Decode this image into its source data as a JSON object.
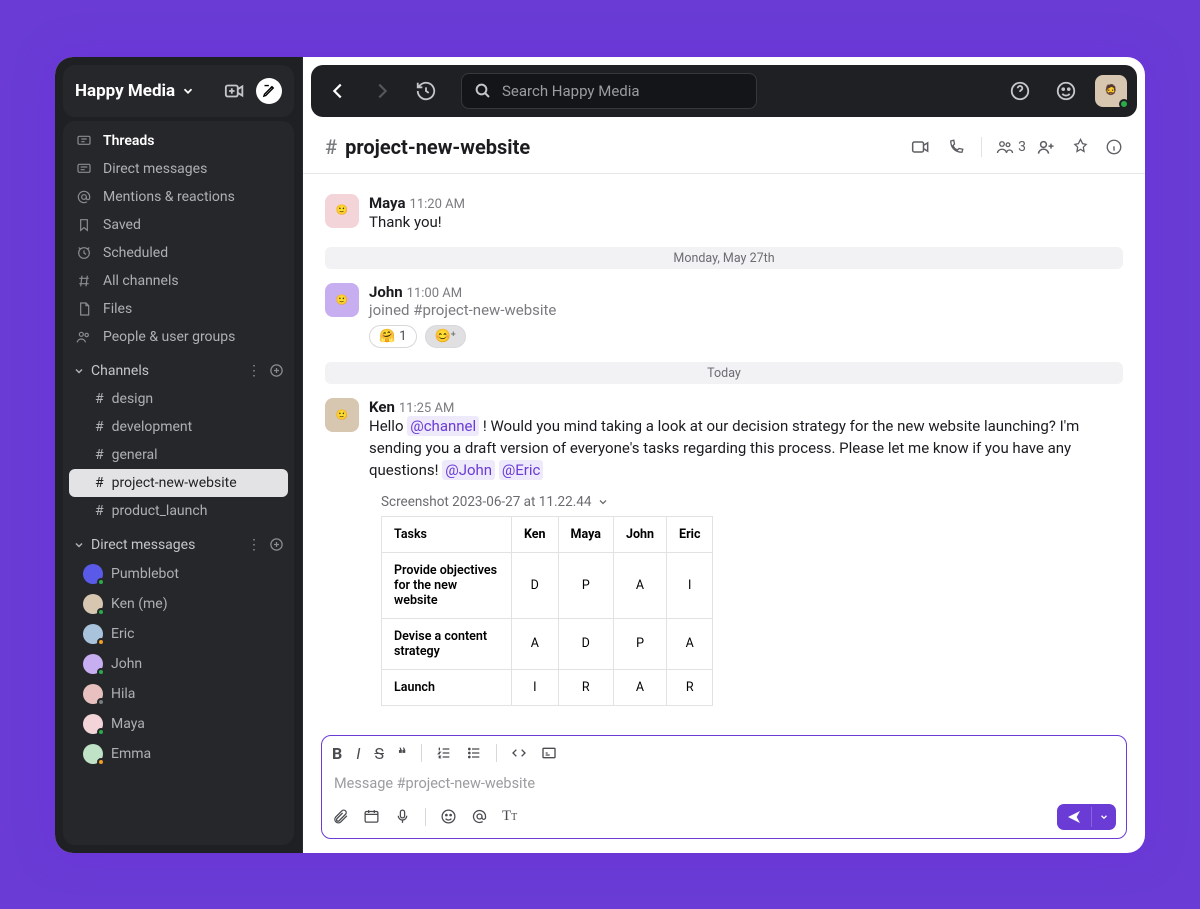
{
  "workspace": {
    "name": "Happy Media"
  },
  "search": {
    "placeholder": "Search Happy Media"
  },
  "nav": [
    {
      "icon": "threads",
      "label": "Threads",
      "active": true
    },
    {
      "icon": "dm",
      "label": "Direct messages"
    },
    {
      "icon": "at",
      "label": "Mentions & reactions"
    },
    {
      "icon": "bookmark",
      "label": "Saved"
    },
    {
      "icon": "clock",
      "label": "Scheduled"
    },
    {
      "icon": "hashes",
      "label": "All channels"
    },
    {
      "icon": "file",
      "label": "Files"
    },
    {
      "icon": "people",
      "label": "People & user groups"
    }
  ],
  "sections": {
    "channels": {
      "title": "Channels",
      "items": [
        {
          "name": "design"
        },
        {
          "name": "development"
        },
        {
          "name": "general"
        },
        {
          "name": "project-new-website",
          "selected": true
        },
        {
          "name": "product_launch"
        }
      ]
    },
    "dms": {
      "title": "Direct messages",
      "items": [
        {
          "name": "Pumblebot",
          "status": "online",
          "color": "#5a5ae8"
        },
        {
          "name": "Ken (me)",
          "status": "online",
          "color": "#d7c6b0"
        },
        {
          "name": "Eric",
          "status": "away",
          "color": "#aac3dd"
        },
        {
          "name": "John",
          "status": "online",
          "color": "#c7aef0"
        },
        {
          "name": "Hila",
          "status": "offline",
          "color": "#e8c0c0"
        },
        {
          "name": "Maya",
          "status": "online",
          "color": "#f3d4d9"
        },
        {
          "name": "Emma",
          "status": "away",
          "color": "#c0e2c6"
        }
      ]
    }
  },
  "channel": {
    "name": "project-new-website",
    "members_count": "3"
  },
  "timeline": [
    {
      "type": "msg",
      "author": "Maya",
      "time": "11:20 AM",
      "text": "Thank you!",
      "avatar": "#f3d4d9"
    },
    {
      "type": "divider",
      "label": "Monday, May 27th"
    },
    {
      "type": "msg",
      "author": "John",
      "time": "11:00 AM",
      "system": "joined #project-new-website",
      "avatar": "#c7aef0",
      "reactions": [
        {
          "emoji": "🤗",
          "count": "1"
        }
      ]
    },
    {
      "type": "divider",
      "label": "Today"
    },
    {
      "type": "msg",
      "author": "Ken",
      "time": "11:25 AM",
      "avatar": "#d7c6b0",
      "rich": [
        {
          "t": "Hello "
        },
        {
          "m": "@channel"
        },
        {
          "t": " ! Would you mind taking a look at our decision strategy for the new website launching? I'm sending you a draft version of everyone's tasks regarding this process. Please let me know if you have any questions!  "
        },
        {
          "m": "@John"
        },
        {
          "t": "   "
        },
        {
          "m": "@Eric"
        }
      ],
      "attachment": {
        "title": "Screenshot 2023-06-27 at 11.22.44",
        "table": {
          "headers": [
            "Tasks",
            "Ken",
            "Maya",
            "John",
            "Eric"
          ],
          "rows": [
            [
              "Provide objectives for the new website",
              "D",
              "P",
              "A",
              "I"
            ],
            [
              "Devise a content strategy",
              "A",
              "D",
              "P",
              "A"
            ],
            [
              "Launch",
              "I",
              "R",
              "A",
              "R"
            ]
          ]
        }
      }
    }
  ],
  "composer": {
    "placeholder": "Message #project-new-website"
  }
}
